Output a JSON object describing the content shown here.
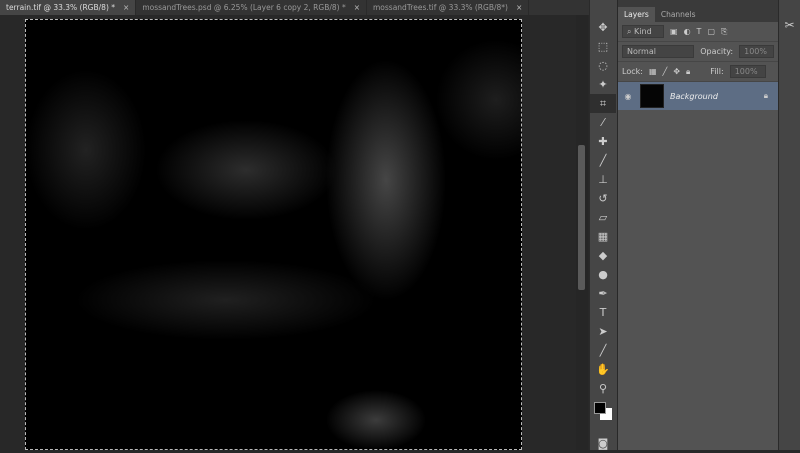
{
  "tabs": [
    {
      "label": "terrain.tif @ 33.3% (RGB/8) *",
      "active": true
    },
    {
      "label": "mossandTrees.psd @ 6.25% (Layer 6 copy 2, RGB/8) *",
      "active": false
    },
    {
      "label": "mossandTrees.tif @ 33.3% (RGB/8*)",
      "active": false
    }
  ],
  "close_glyph": "×",
  "layers_panel": {
    "tabs": [
      "Layers",
      "Channels"
    ],
    "filter_kind": "Kind",
    "blend_mode": "Normal",
    "opacity_label": "Opacity:",
    "opacity_value": "100%",
    "lock_label": "Lock:",
    "fill_label": "Fill:",
    "fill_value": "100%",
    "layers": [
      {
        "name": "Background",
        "visible": true,
        "locked": true
      }
    ]
  },
  "tools": [
    "move",
    "rectangular-marquee",
    "lasso",
    "magic-wand",
    "crop",
    "eyedropper",
    "spot-healing",
    "brush",
    "clone-stamp",
    "history-brush",
    "eraser",
    "gradient",
    "blur",
    "dodge",
    "pen",
    "type",
    "path-selection",
    "line",
    "hand",
    "zoom"
  ],
  "tool_glyphs": {
    "type": "T"
  },
  "colors": {
    "foreground": "#000000",
    "background": "#ffffff",
    "layer_selected": "#5d6d84"
  }
}
